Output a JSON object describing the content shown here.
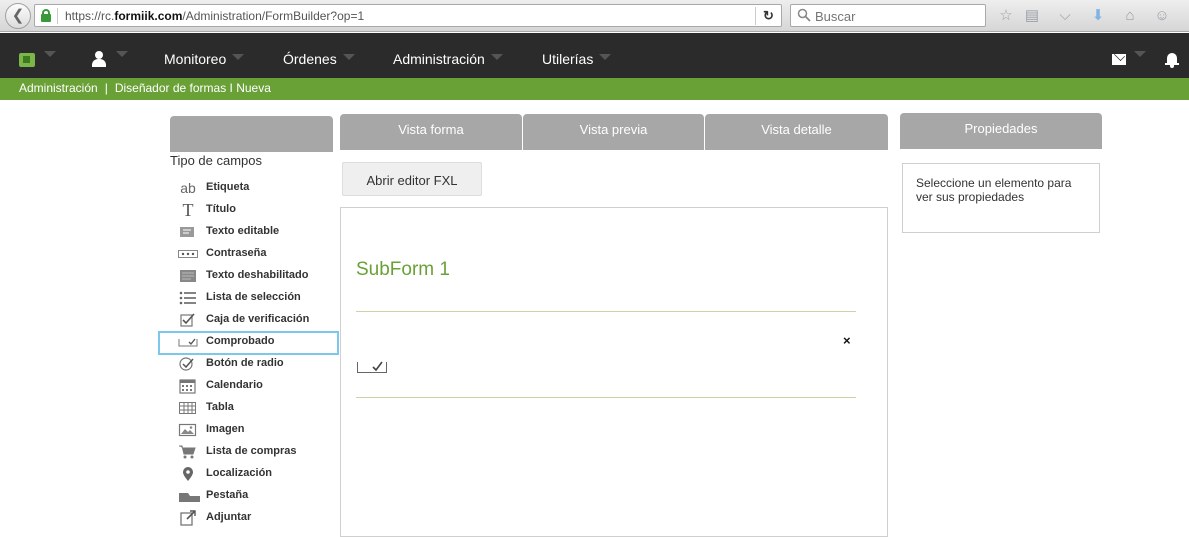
{
  "browser": {
    "url_prefix": "https://rc.",
    "url_domain": "formiik.com",
    "url_path": "/Administration/FormBuilder?op=1",
    "search_placeholder": "Buscar"
  },
  "nav": {
    "items": [
      {
        "label": "Monitoreo"
      },
      {
        "label": "Órdenes"
      },
      {
        "label": "Administración"
      },
      {
        "label": "Utilerías"
      }
    ]
  },
  "breadcrumb": {
    "section": "Administración",
    "separator": "|",
    "page": "Diseñador de formas I Nueva"
  },
  "sidebar": {
    "title": "Tipo de campos",
    "items": [
      {
        "label": "Etiqueta",
        "icon": "ab"
      },
      {
        "label": "Título",
        "icon": "T"
      },
      {
        "label": "Texto editable",
        "icon": "text-editable-icon"
      },
      {
        "label": "Contraseña",
        "icon": "•••"
      },
      {
        "label": "Texto deshabilitado",
        "icon": "text-disabled-icon"
      },
      {
        "label": "Lista de selección",
        "icon": "list-icon"
      },
      {
        "label": "Caja de verificación",
        "icon": "checkbox-icon"
      },
      {
        "label": "Comprobado",
        "icon": "checked-icon"
      },
      {
        "label": "Botón de radio",
        "icon": "radio-icon"
      },
      {
        "label": "Calendario",
        "icon": "calendar-icon"
      },
      {
        "label": "Tabla",
        "icon": "table-icon"
      },
      {
        "label": "Imagen",
        "icon": "image-icon"
      },
      {
        "label": "Lista de compras",
        "icon": "cart-icon"
      },
      {
        "label": "Localización",
        "icon": "location-icon"
      },
      {
        "label": "Pestaña",
        "icon": "tab-icon"
      },
      {
        "label": "Adjuntar",
        "icon": "attach-icon"
      }
    ],
    "selected_index": 7
  },
  "tabs": [
    {
      "label": "Vista forma"
    },
    {
      "label": "Vista previa"
    },
    {
      "label": "Vista detalle"
    }
  ],
  "toolbar": {
    "fxl_label": "Abrir editor FXL"
  },
  "canvas": {
    "subform_title": "SubForm 1",
    "close_glyph": "×"
  },
  "properties": {
    "title": "Propiedades",
    "hint": "Seleccione un elemento para ver sus propiedades"
  },
  "colors": {
    "accent_green": "#6aa137",
    "nav_bg": "#2b2b2b",
    "tab_gray": "#a7a7a7",
    "selection_blue": "#7cc8ec"
  }
}
